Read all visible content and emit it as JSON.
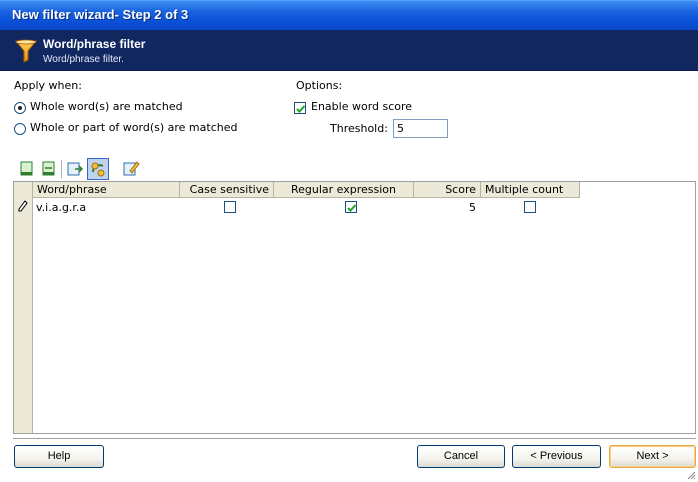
{
  "window": {
    "title": "New filter wizard- Step 2 of 3"
  },
  "header": {
    "title": "Word/phrase filter",
    "subtitle": "Word/phrase filter.",
    "icon": "funnel-icon"
  },
  "apply_when": {
    "label": "Apply when:",
    "options": [
      {
        "label": "Whole word(s) are matched",
        "selected": true
      },
      {
        "label": "Whole or part of word(s) are matched",
        "selected": false
      }
    ]
  },
  "options": {
    "label": "Options:",
    "enable_word_score": {
      "label": "Enable word score",
      "checked": true
    },
    "threshold": {
      "label": "Threshold:",
      "value": "5"
    }
  },
  "toolbar": {
    "icons": [
      "new-item-icon",
      "insert-item-icon",
      "export-icon",
      "import-icon",
      "edit-icon"
    ],
    "selected_index": 3
  },
  "grid": {
    "columns": [
      "Word/phrase",
      "Case sensitive",
      "Regular expression",
      "Score",
      "Multiple count"
    ],
    "rows": [
      {
        "word": "v.i.a.g.r.a",
        "case_sensitive": false,
        "regular_expression": true,
        "score": "5",
        "multiple_count": false
      }
    ]
  },
  "buttons": {
    "help": "Help",
    "cancel": "Cancel",
    "previous": "< Previous",
    "next": "Next >"
  },
  "colors": {
    "title_bar": "#0a50d8",
    "header_bg": "#102760",
    "accent_default_button": "#e9a740"
  }
}
